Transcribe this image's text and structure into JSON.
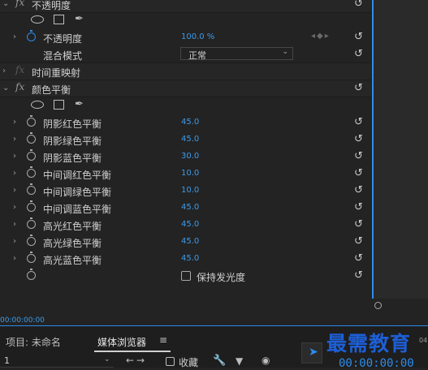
{
  "effects": {
    "opacity_section": {
      "title": "不透明度",
      "fx": "fx"
    },
    "opacity_param": {
      "label": "不透明度",
      "value": "100.0 %"
    },
    "blend_mode": {
      "label": "混合模式",
      "value": "正常"
    },
    "time_remap": {
      "title": "时间重映射",
      "fx": "fx"
    },
    "color_balance": {
      "title": "颜色平衡",
      "fx": "fx",
      "params": [
        {
          "label": "阴影红色平衡",
          "value": "45.0"
        },
        {
          "label": "阴影绿色平衡",
          "value": "45.0"
        },
        {
          "label": "阴影蓝色平衡",
          "value": "30.0"
        },
        {
          "label": "中间调红色平衡",
          "value": "10.0"
        },
        {
          "label": "中间调绿色平衡",
          "value": "10.0"
        },
        {
          "label": "中间调蓝色平衡",
          "value": "45.0"
        },
        {
          "label": "高光红色平衡",
          "value": "45.0"
        },
        {
          "label": "高光绿色平衡",
          "value": "45.0"
        },
        {
          "label": "高光蓝色平衡",
          "value": "45.0"
        }
      ],
      "preserve_luminosity": "保持发光度"
    }
  },
  "timeline": {
    "timecode": "00:00:00:00"
  },
  "bottom": {
    "tab_project": "项目: 未命名",
    "tab_media": "媒体浏览器",
    "dropdown_value": "1",
    "favorites_label": "收藏",
    "timecode": "00:00:00:00",
    "corner_label": "04"
  },
  "watermark": "最需教育",
  "colors": {
    "accent": "#2d8ceb",
    "value_blue": "#3d9be9",
    "background": "#232323"
  }
}
